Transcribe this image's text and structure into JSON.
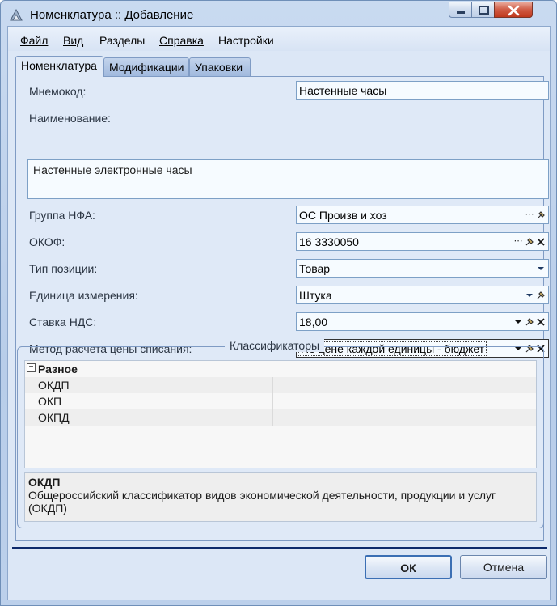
{
  "window": {
    "title": "Номенклатура :: Добавление"
  },
  "menu": [
    "Файл",
    "Вид",
    "Разделы",
    "Справка",
    "Настройки"
  ],
  "tabs": [
    "Номенклатура",
    "Модификации",
    "Упаковки"
  ],
  "form": {
    "mnemocode_label": "Мнемокод:",
    "mnemocode_value": "Настенные часы",
    "name_label": "Наименование:",
    "name_value": "Настенные электронные часы",
    "nfa_group_label": "Группа НФА:",
    "nfa_group_value": "ОС Произв и хоз",
    "okof_label": "ОКОФ:",
    "okof_value": "16 3330050",
    "position_type_label": "Тип позиции:",
    "position_type_value": "Товар",
    "unit_label": "Единица измерения:",
    "unit_value": "Штука",
    "vat_label": "Ставка НДС:",
    "vat_value": "18,00",
    "price_method_label": "Метод расчета цены списания:",
    "price_method_value": "По цене каждой единицы - бюджет"
  },
  "classifiers": {
    "title": "Классификаторы",
    "category": "Разное",
    "rows": [
      "ОКДП",
      "ОКП",
      "ОКПД"
    ],
    "description_title": "ОКДП",
    "description_text": "Общероссийский классификатор видов экономической деятельности, продукции и услуг (ОКДП)"
  },
  "buttons": {
    "ok": "ОК",
    "cancel": "Отмена"
  },
  "colors": {
    "accent": "#0d2a6b",
    "field_border": "#7da0c6",
    "panel_bg": "#dfe9f7"
  }
}
